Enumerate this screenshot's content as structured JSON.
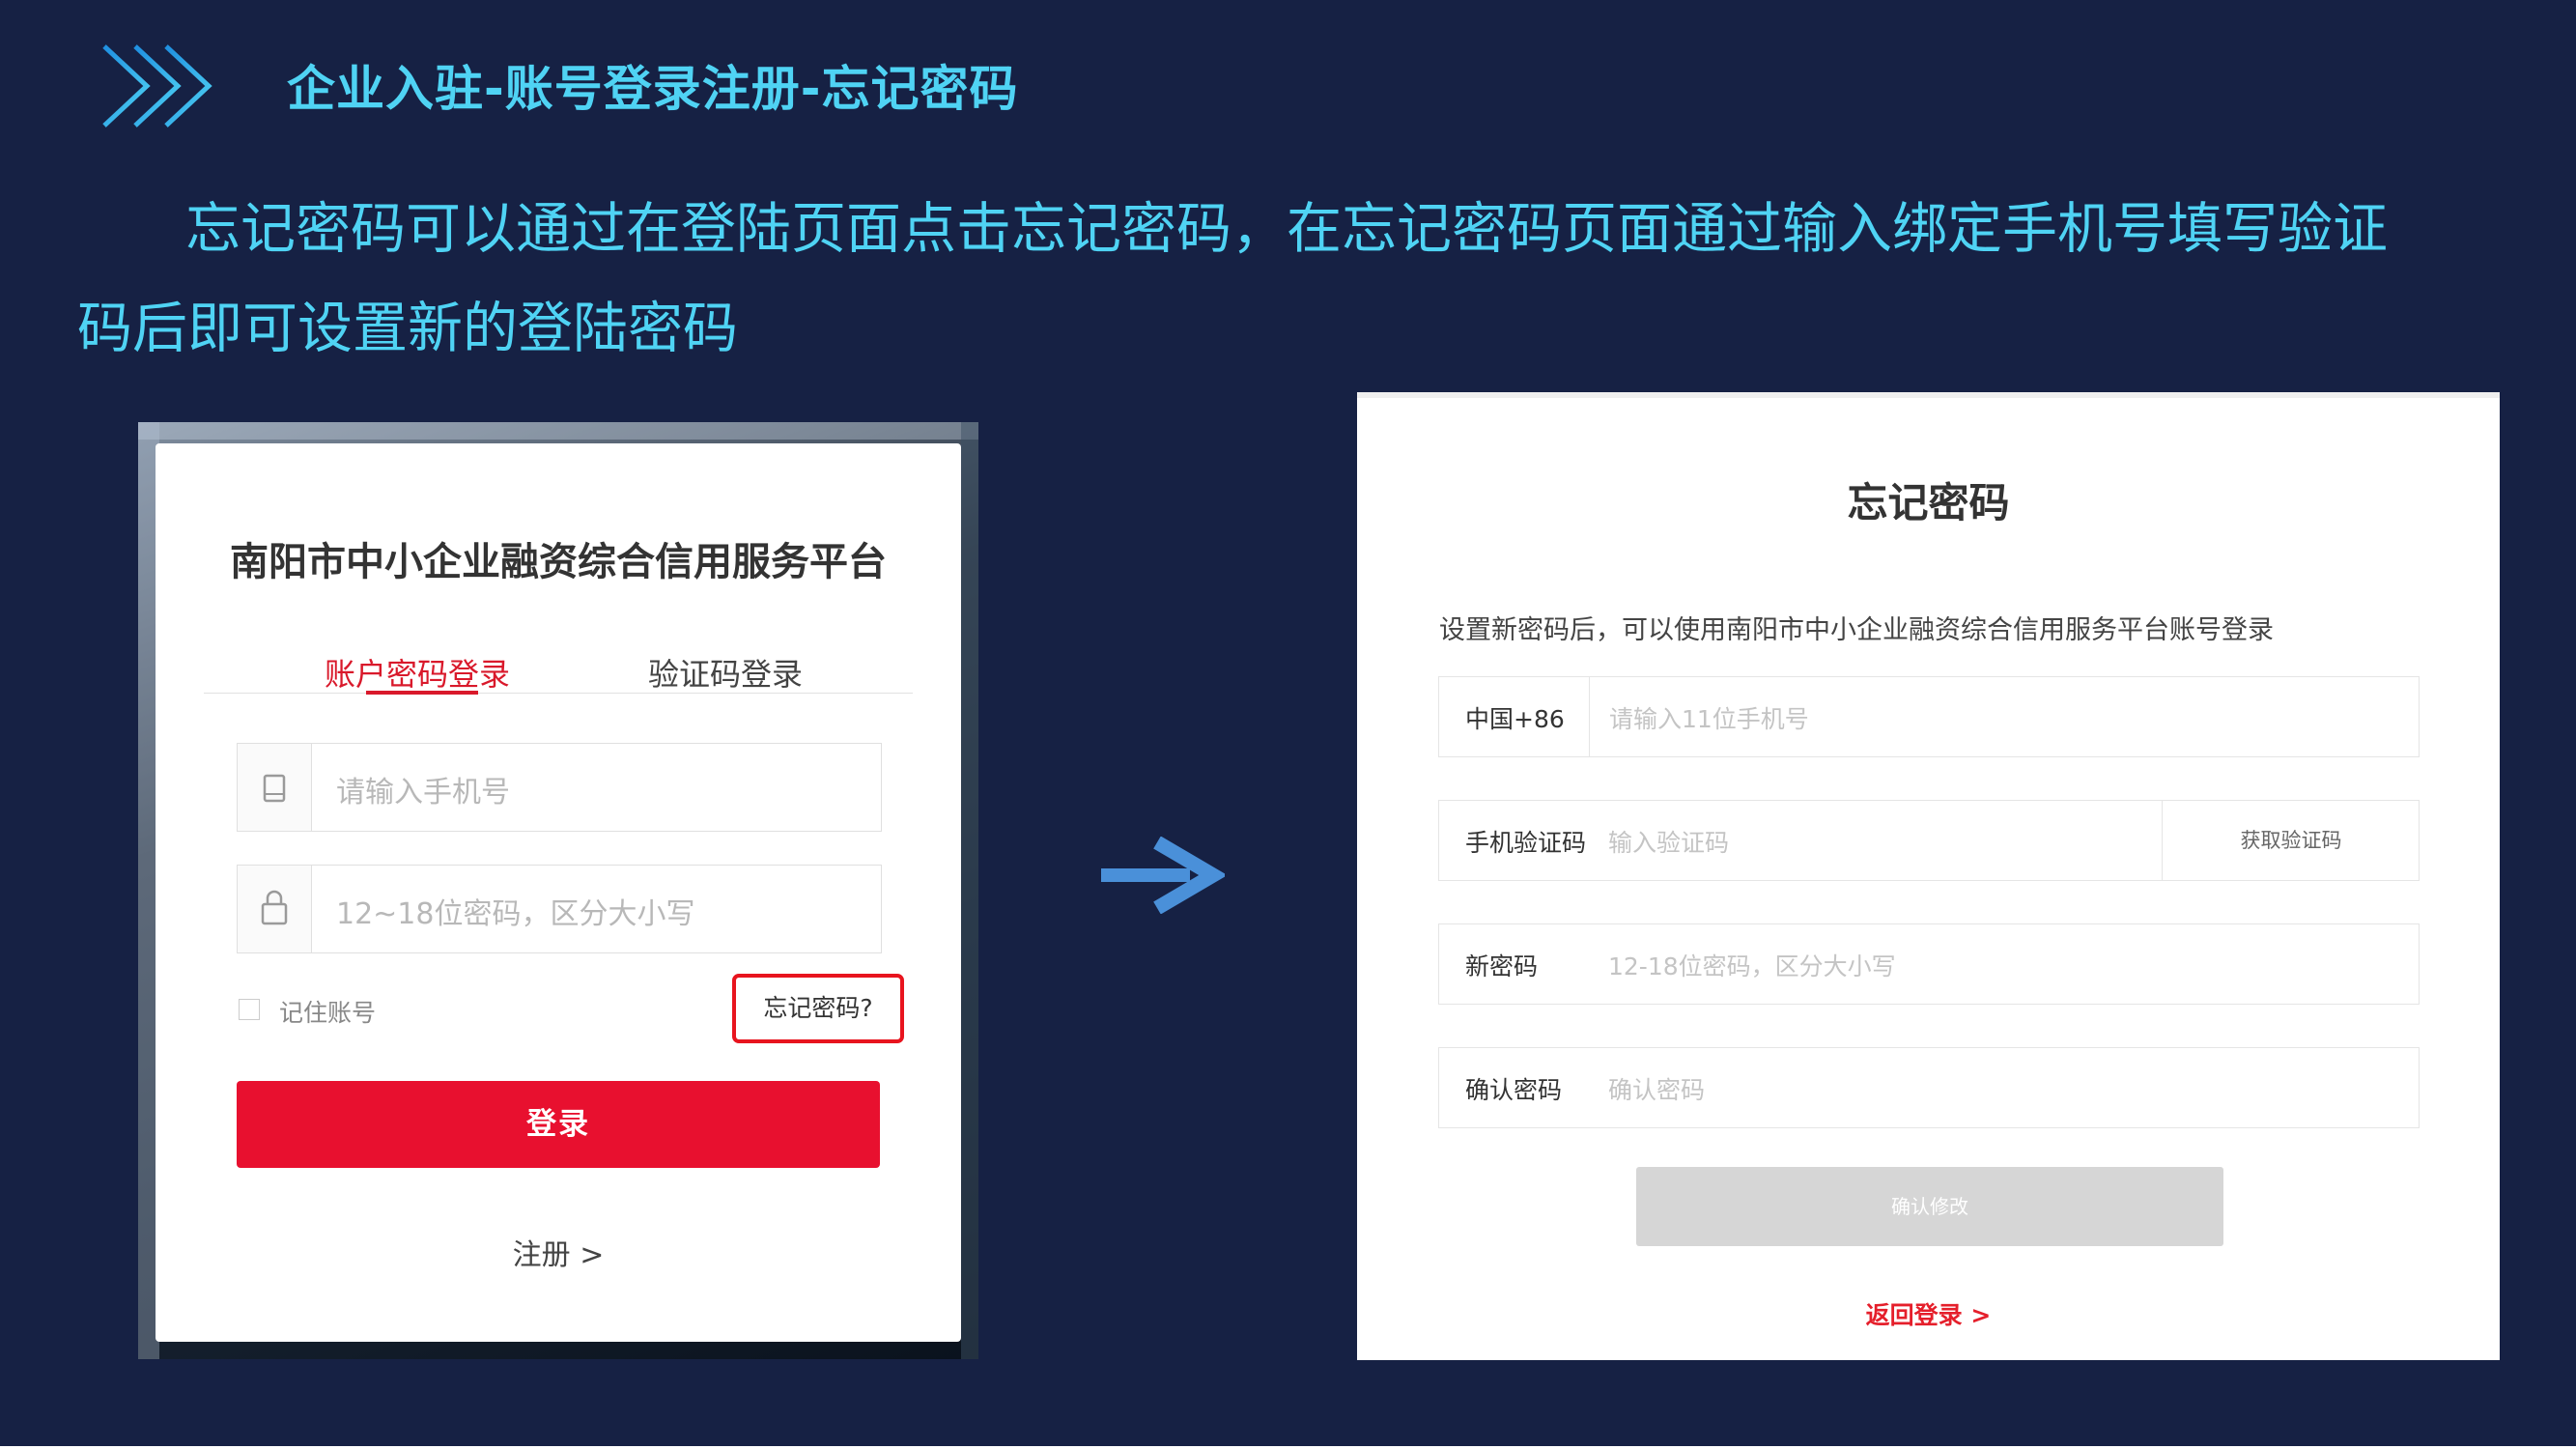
{
  "header": {
    "title": "企业入驻-账号登录注册-忘记密码",
    "icon": "triple-chevron-icon"
  },
  "intro": {
    "text": "忘记密码可以通过在登陆页面点击忘记密码，在忘记密码页面通过输入绑定手机号填写验证码后即可设置新的登陆密码"
  },
  "login": {
    "platform_title": "南阳市中小企业融资综合信用服务平台",
    "tabs": [
      {
        "label": "账户密码登录",
        "active": true
      },
      {
        "label": "验证码登录",
        "active": false
      }
    ],
    "phone": {
      "placeholder": "请输入手机号",
      "icon": "phone-icon"
    },
    "password": {
      "placeholder": "12~18位密码，区分大小写",
      "icon": "lock-icon"
    },
    "remember_label": "记住账号",
    "forgot_link": "忘记密码?",
    "login_button": "登录",
    "register_link": "注册 >"
  },
  "arrow": {
    "icon": "right-arrow-icon",
    "color": "#4a90d9"
  },
  "forgot": {
    "title": "忘记密码",
    "description": "设置新密码后，可以使用南阳市中小企业融资综合信用服务平台账号登录",
    "phone_row": {
      "prefix": "中国+86",
      "placeholder": "请输入11位手机号"
    },
    "code_row": {
      "label": "手机验证码",
      "placeholder": "输入验证码",
      "button": "获取验证码"
    },
    "new_password_row": {
      "label": "新密码",
      "placeholder": "12-18位密码，区分大小写"
    },
    "confirm_password_row": {
      "label": "确认密码",
      "placeholder": "确认密码"
    },
    "confirm_button": "确认修改",
    "back_link": "返回登录 >"
  },
  "colors": {
    "background": "#162144",
    "accent_cyan": "#4fd3f4",
    "brand_red": "#e8102f",
    "link_red": "#e51f2b"
  }
}
